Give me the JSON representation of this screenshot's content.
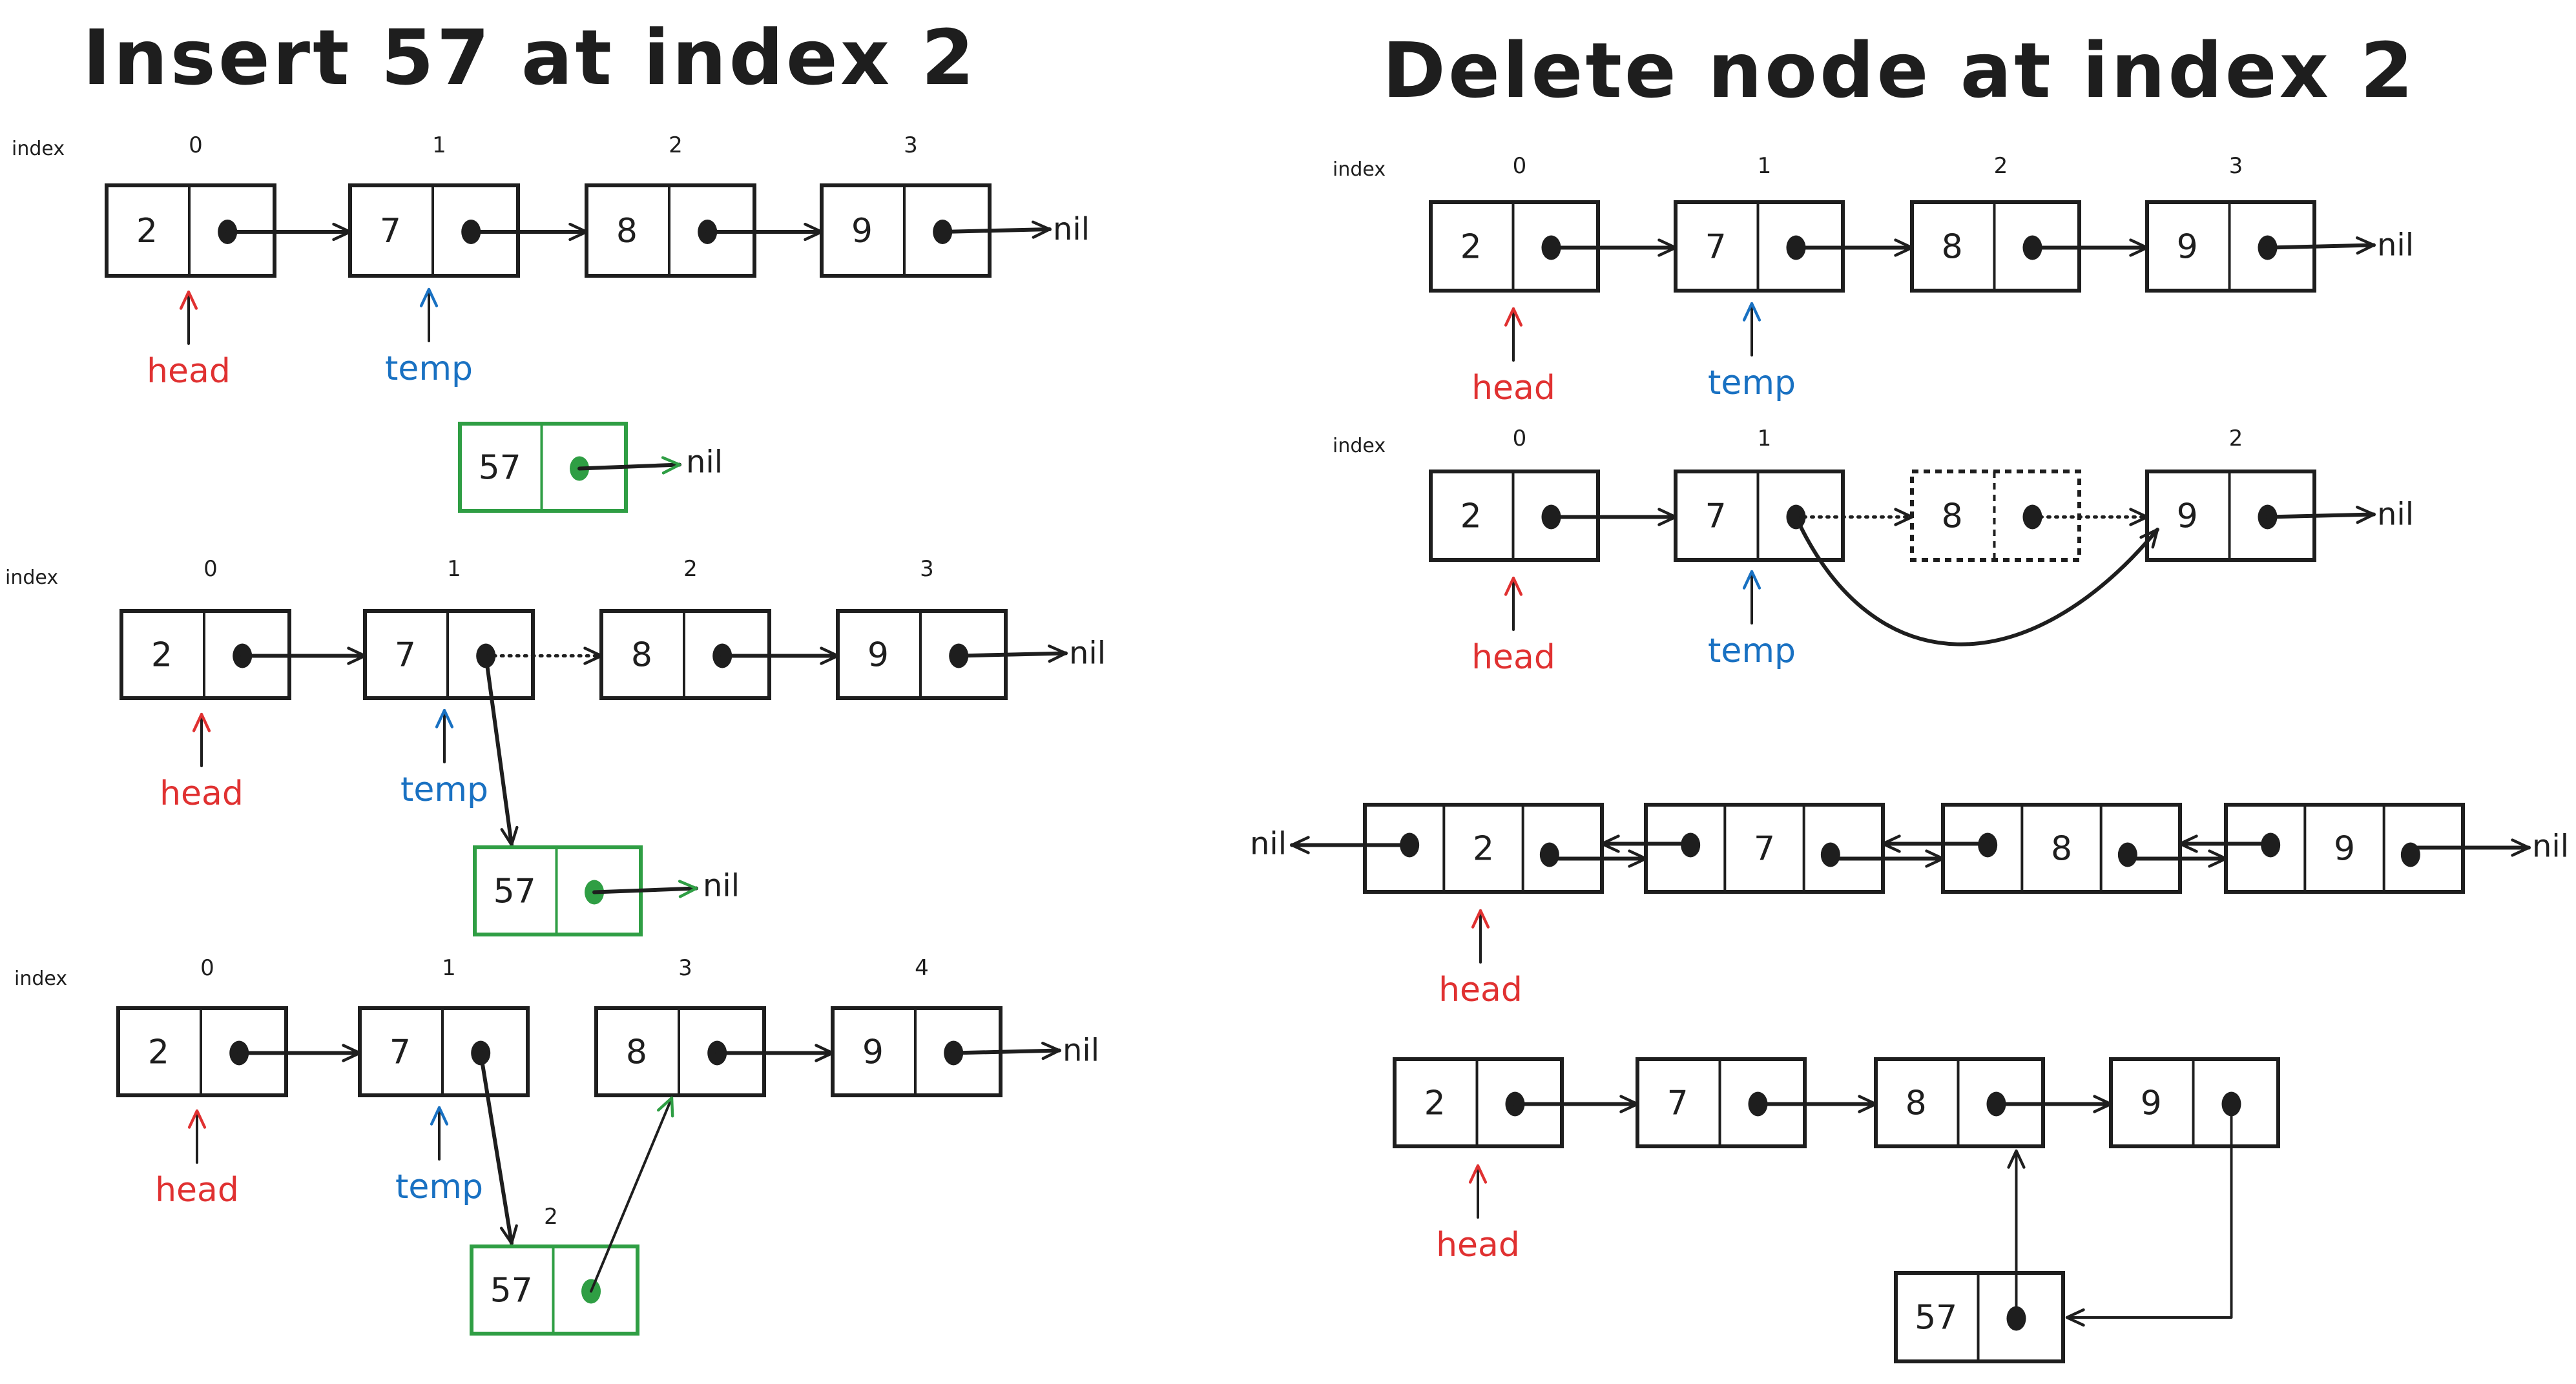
{
  "colors": {
    "ink": "#1e1e1e",
    "head": "#e03131",
    "temp": "#1971c2",
    "new_node": "#2f9e44"
  },
  "insert": {
    "title": "Insert 57 at index 2",
    "index_label": "index",
    "step1": {
      "indices": [
        "0",
        "1",
        "2",
        "3"
      ],
      "values": [
        "2",
        "7",
        "8",
        "9"
      ],
      "nil": "nil",
      "head_label": "head",
      "temp_label": "temp",
      "new_node_value": "57",
      "new_node_nil": "nil"
    },
    "step2": {
      "indices": [
        "0",
        "1",
        "2",
        "3"
      ],
      "values": [
        "2",
        "7",
        "8",
        "9"
      ],
      "nil": "nil",
      "head_label": "head",
      "temp_label": "temp",
      "new_node_value": "57",
      "new_node_nil": "nil"
    },
    "step3": {
      "indices": [
        "0",
        "1",
        "3",
        "4"
      ],
      "values": [
        "2",
        "7",
        "8",
        "9"
      ],
      "nil": "nil",
      "head_label": "head",
      "temp_label": "temp",
      "new_node_index": "2",
      "new_node_value": "57"
    }
  },
  "delete": {
    "title": "Delete node at index 2",
    "index_label": "index",
    "step1": {
      "indices": [
        "0",
        "1",
        "2",
        "3"
      ],
      "values": [
        "2",
        "7",
        "8",
        "9"
      ],
      "nil": "nil",
      "head_label": "head",
      "temp_label": "temp"
    },
    "step2": {
      "indices": [
        "0",
        "1",
        "2"
      ],
      "values": [
        "2",
        "7",
        "8",
        "9"
      ],
      "removed_value": "8",
      "nil": "nil",
      "head_label": "head",
      "temp_label": "temp"
    }
  },
  "doubly": {
    "values": [
      "2",
      "7",
      "8",
      "9"
    ],
    "nil_left": "nil",
    "nil_right": "nil",
    "head_label": "head"
  },
  "circular_example": {
    "values": [
      "2",
      "7",
      "8",
      "9"
    ],
    "extra_value": "57",
    "head_label": "head"
  }
}
